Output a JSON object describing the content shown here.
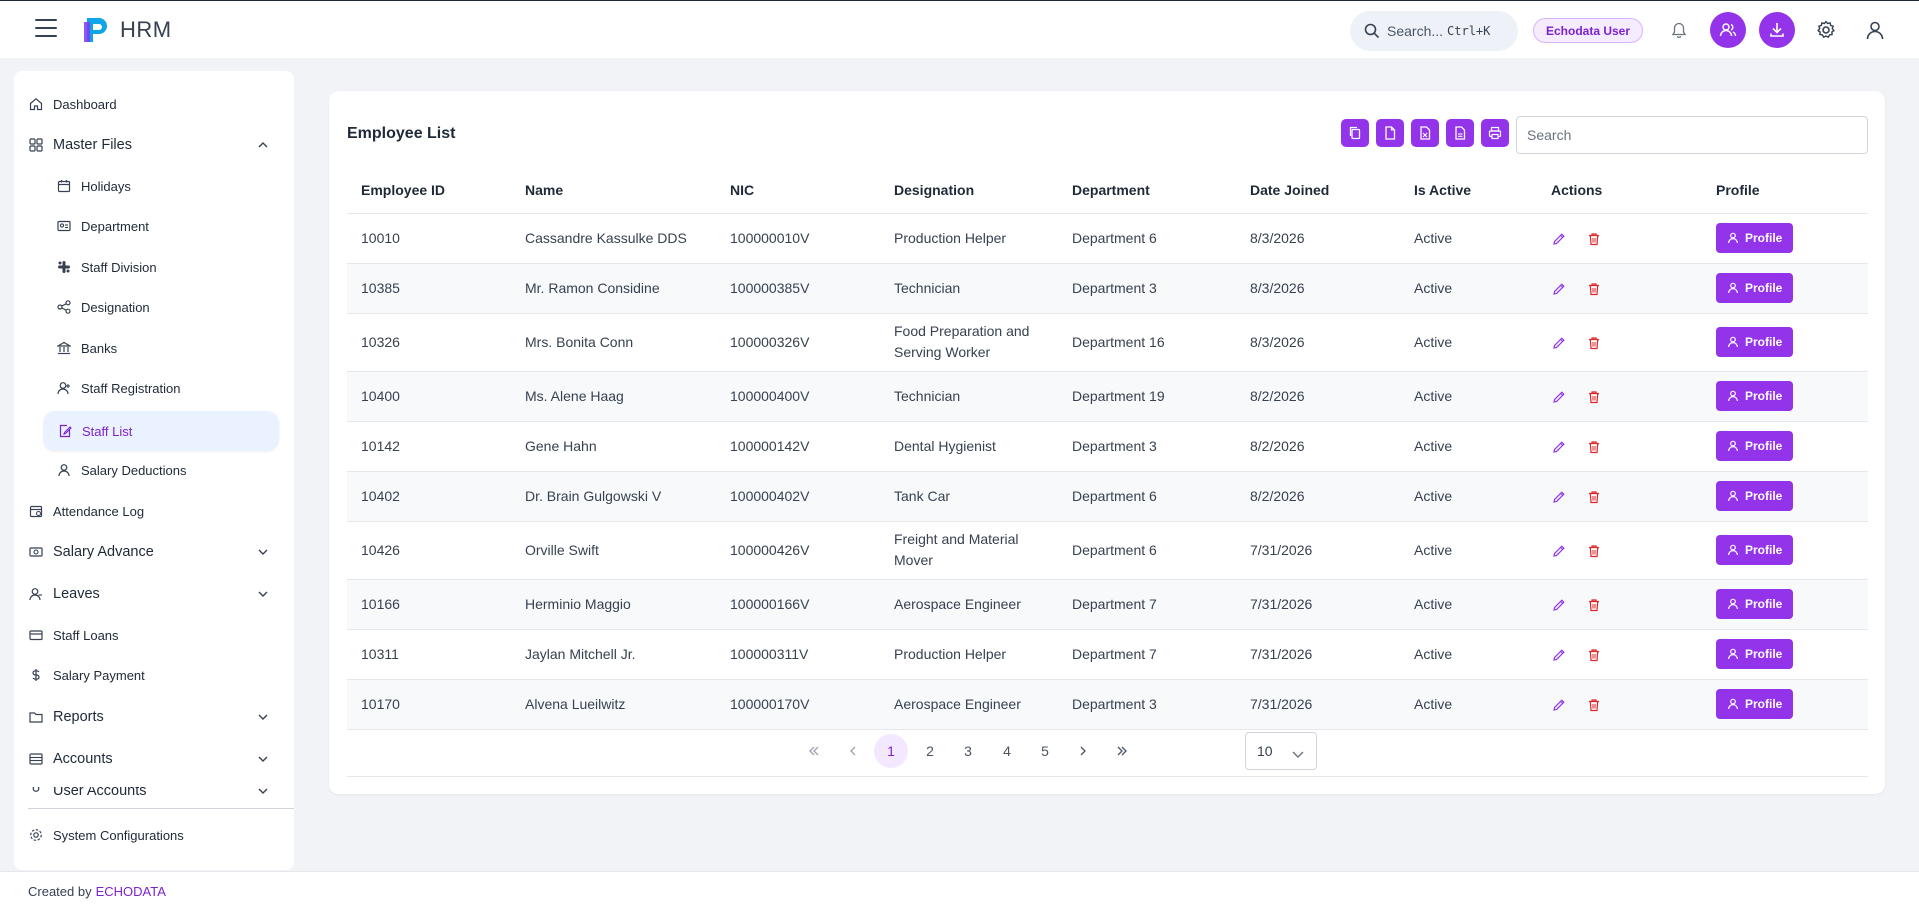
{
  "app": {
    "title": "HRM"
  },
  "header": {
    "search_label": "Search...",
    "search_shortcut": "Ctrl+K",
    "user_name": "Echodata User"
  },
  "sidebar": {
    "items": [
      {
        "label": "Dashboard",
        "icon": "home-icon"
      },
      {
        "label": "Master Files",
        "icon": "grid-icon",
        "expanded": true
      },
      {
        "label": "Holidays",
        "icon": "calendar-icon"
      },
      {
        "label": "Department",
        "icon": "id-card-icon"
      },
      {
        "label": "Staff Division",
        "icon": "network-icon"
      },
      {
        "label": "Designation",
        "icon": "share-icon"
      },
      {
        "label": "Banks",
        "icon": "bank-icon"
      },
      {
        "label": "Staff Registration",
        "icon": "user-plus-icon"
      },
      {
        "label": "Staff List",
        "icon": "edit-file-icon",
        "active": true
      },
      {
        "label": "Salary Deductions",
        "icon": "user-icon"
      },
      {
        "label": "Attendance Log",
        "icon": "calendar-check-icon"
      },
      {
        "label": "Salary Advance",
        "icon": "cash-icon"
      },
      {
        "label": "Leaves",
        "icon": "user-minus-icon"
      },
      {
        "label": "Staff Loans",
        "icon": "card-icon"
      },
      {
        "label": "Salary Payment",
        "icon": "dollar-icon"
      },
      {
        "label": "Reports",
        "icon": "folder-icon"
      },
      {
        "label": "Accounts",
        "icon": "ledger-icon"
      },
      {
        "label": "User Accounts",
        "icon": "users-icon"
      }
    ],
    "system_config": "System Configurations"
  },
  "main": {
    "title": "Employee List",
    "search_placeholder": "Search",
    "toolbar": [
      "copy-icon",
      "csv-icon",
      "excel-icon",
      "pdf-icon",
      "print-icon"
    ],
    "columns": [
      "Employee ID",
      "Name",
      "NIC",
      "Designation",
      "Department",
      "Date Joined",
      "Is Active",
      "Actions",
      "Profile"
    ],
    "rows": [
      {
        "id": "10010",
        "name": "Cassandre Kassulke DDS",
        "nic": "100000010V",
        "designation": "Production Helper",
        "department": "Department 6",
        "joined": "8/3/2026",
        "active": "Active"
      },
      {
        "id": "10385",
        "name": "Mr. Ramon Considine",
        "nic": "100000385V",
        "designation": "Technician",
        "department": "Department 3",
        "joined": "8/3/2026",
        "active": "Active"
      },
      {
        "id": "10326",
        "name": "Mrs. Bonita Conn",
        "nic": "100000326V",
        "designation": "Food Preparation and Serving Worker",
        "department": "Department 16",
        "joined": "8/3/2026",
        "active": "Active"
      },
      {
        "id": "10400",
        "name": "Ms. Alene Haag",
        "nic": "100000400V",
        "designation": "Technician",
        "department": "Department 19",
        "joined": "8/2/2026",
        "active": "Active"
      },
      {
        "id": "10142",
        "name": "Gene Hahn",
        "nic": "100000142V",
        "designation": "Dental Hygienist",
        "department": "Department 3",
        "joined": "8/2/2026",
        "active": "Active"
      },
      {
        "id": "10402",
        "name": "Dr. Brain Gulgowski V",
        "nic": "100000402V",
        "designation": "Tank Car",
        "department": "Department 6",
        "joined": "8/2/2026",
        "active": "Active"
      },
      {
        "id": "10426",
        "name": "Orville Swift",
        "nic": "100000426V",
        "designation": "Freight and Material Mover",
        "department": "Department 6",
        "joined": "7/31/2026",
        "active": "Active"
      },
      {
        "id": "10166",
        "name": "Herminio Maggio",
        "nic": "100000166V",
        "designation": "Aerospace Engineer",
        "department": "Department 7",
        "joined": "7/31/2026",
        "active": "Active"
      },
      {
        "id": "10311",
        "name": "Jaylan Mitchell Jr.",
        "nic": "100000311V",
        "designation": "Production Helper",
        "department": "Department 7",
        "joined": "7/31/2026",
        "active": "Active"
      },
      {
        "id": "10170",
        "name": "Alvena Lueilwitz",
        "nic": "100000170V",
        "designation": "Aerospace Engineer",
        "department": "Department 3",
        "joined": "7/31/2026",
        "active": "Active"
      }
    ],
    "profile_label": "Profile",
    "pagination": {
      "pages": [
        "1",
        "2",
        "3",
        "4",
        "5"
      ],
      "current": "1",
      "page_size": "10"
    }
  },
  "footer": {
    "created_by": "Created by",
    "brand": "ECHODATA"
  },
  "colors": {
    "accent": "#9333ea",
    "accent_light": "#f3e8ff",
    "delete": "#dc2626"
  }
}
